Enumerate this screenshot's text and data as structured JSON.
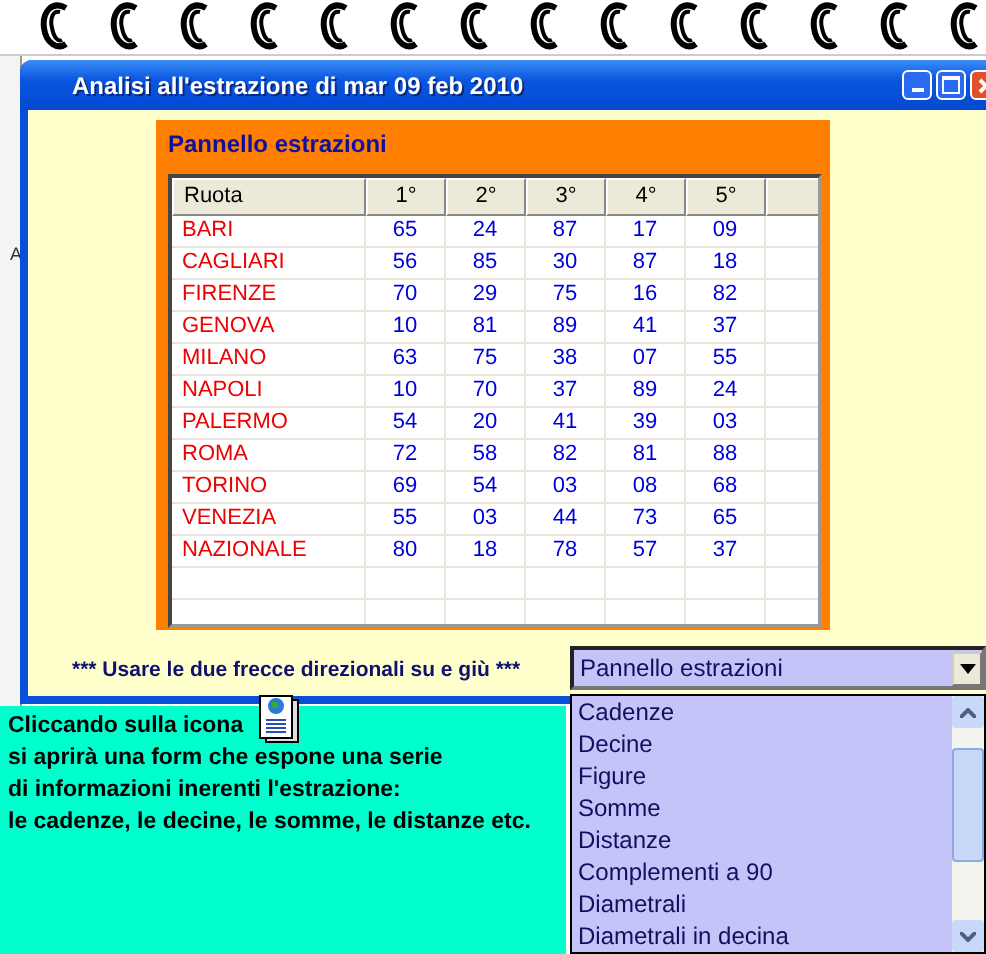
{
  "background_text": "A",
  "window": {
    "title": "Analisi all'estrazione di mar 09 feb 2010"
  },
  "panel": {
    "title": "Pannello estrazioni",
    "table": {
      "columns": [
        "Ruota",
        "1°",
        "2°",
        "3°",
        "4°",
        "5°"
      ],
      "rows": [
        {
          "ruota": "BARI",
          "numbers": [
            "65",
            "24",
            "87",
            "17",
            "09"
          ]
        },
        {
          "ruota": "CAGLIARI",
          "numbers": [
            "56",
            "85",
            "30",
            "87",
            "18"
          ]
        },
        {
          "ruota": "FIRENZE",
          "numbers": [
            "70",
            "29",
            "75",
            "16",
            "82"
          ]
        },
        {
          "ruota": "GENOVA",
          "numbers": [
            "10",
            "81",
            "89",
            "41",
            "37"
          ]
        },
        {
          "ruota": "MILANO",
          "numbers": [
            "63",
            "75",
            "38",
            "07",
            "55"
          ]
        },
        {
          "ruota": "NAPOLI",
          "numbers": [
            "10",
            "70",
            "37",
            "89",
            "24"
          ]
        },
        {
          "ruota": "PALERMO",
          "numbers": [
            "54",
            "20",
            "41",
            "39",
            "03"
          ]
        },
        {
          "ruota": "ROMA",
          "numbers": [
            "72",
            "58",
            "82",
            "81",
            "88"
          ]
        },
        {
          "ruota": "TORINO",
          "numbers": [
            "69",
            "54",
            "03",
            "08",
            "68"
          ]
        },
        {
          "ruota": "VENEZIA",
          "numbers": [
            "55",
            "03",
            "44",
            "73",
            "65"
          ]
        },
        {
          "ruota": "NAZIONALE",
          "numbers": [
            "80",
            "18",
            "78",
            "57",
            "37"
          ]
        }
      ]
    }
  },
  "hint": "*** Usare le due frecce direzionali su e giù ***",
  "dropdown": {
    "value": "Pannello estrazioni",
    "expanded": true,
    "options": [
      "Cadenze",
      "Decine",
      "Figure",
      "Somme",
      "Distanze",
      "Complementi a 90",
      "Diametrali",
      "Diametrali in decina"
    ]
  },
  "note": {
    "lines": [
      "Cliccando sulla icona",
      "si aprirà una form che espone una serie",
      "di informazioni inerenti l'estrazione:",
      "le cadenze, le decine, le somme, le distanze etc."
    ]
  }
}
